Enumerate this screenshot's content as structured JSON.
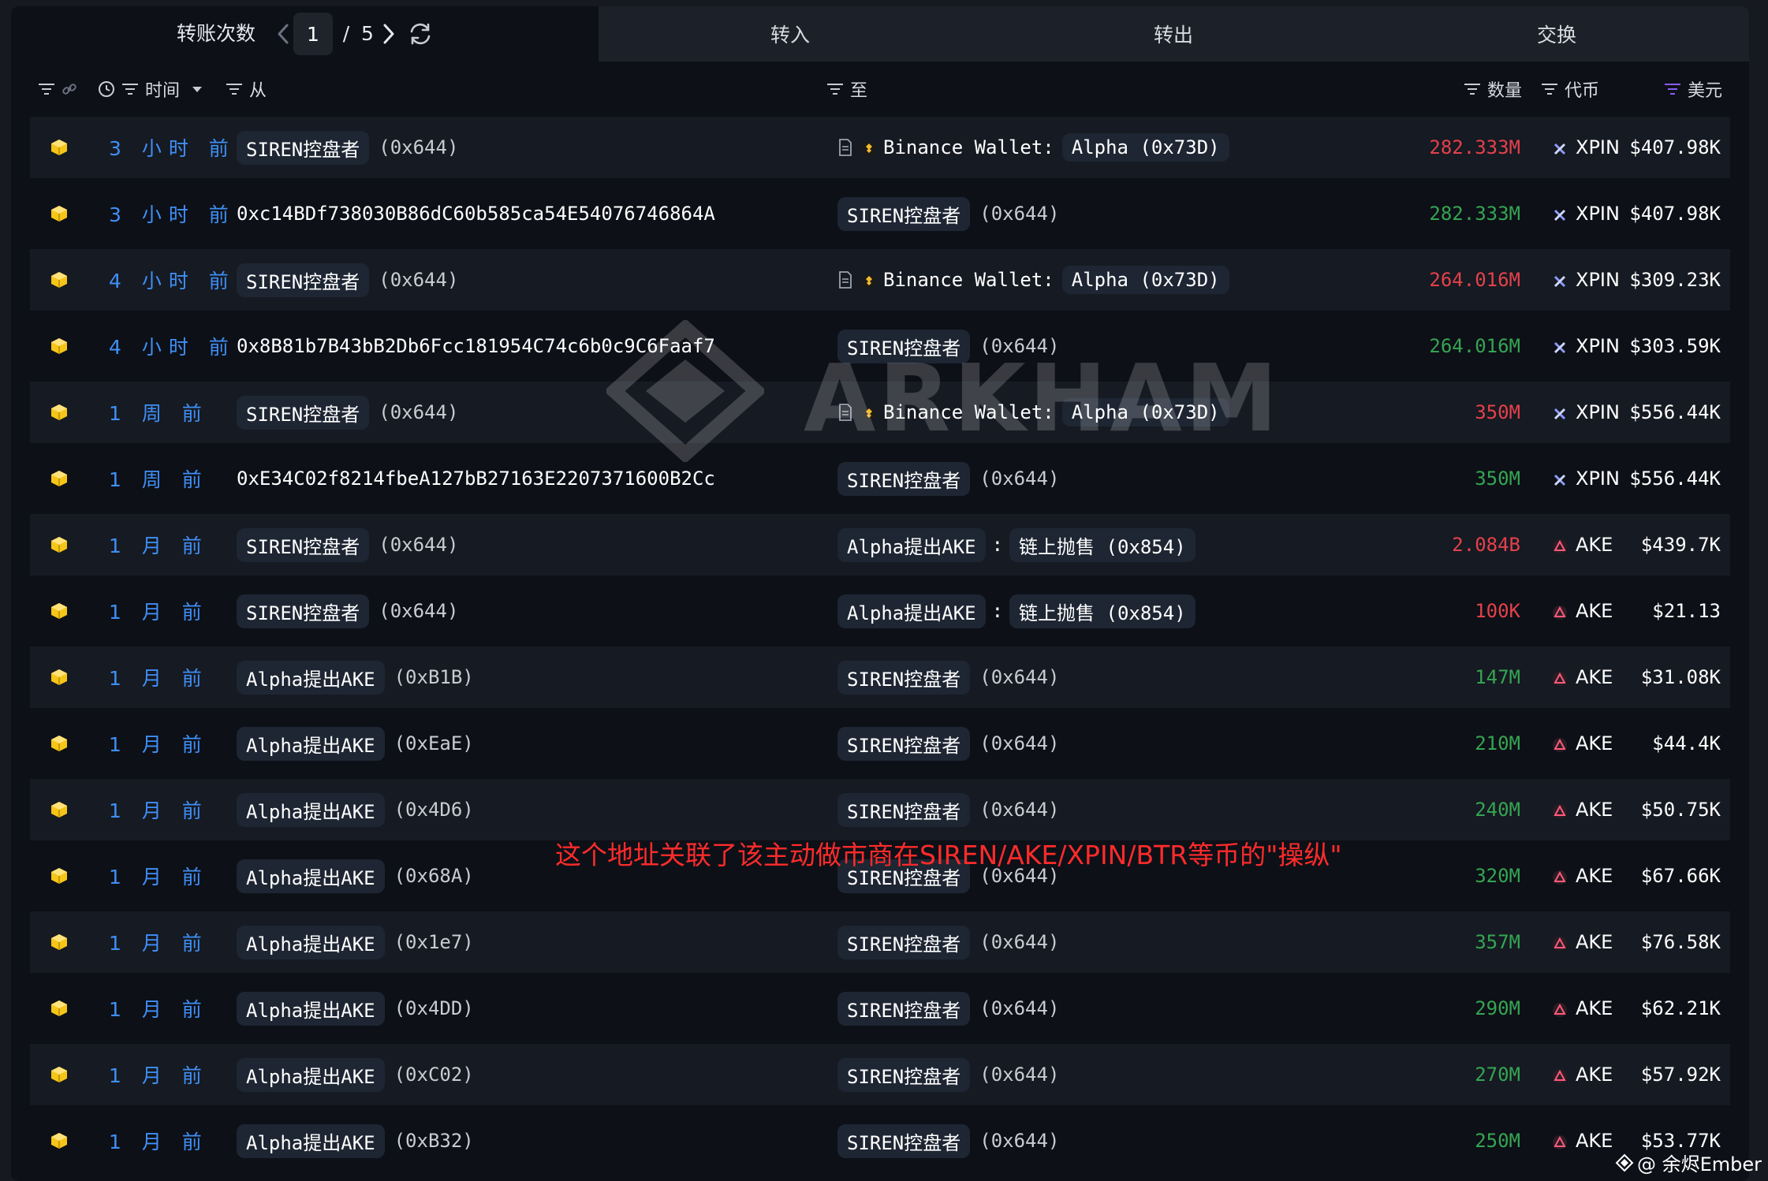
{
  "header": {
    "count_label": "转账次数",
    "page_current": "1",
    "page_sep": "/",
    "page_total": "5",
    "tabs": [
      "转入",
      "转出",
      "交换"
    ]
  },
  "columns": {
    "time": "时间",
    "from": "从",
    "to": "至",
    "qty": "数量",
    "token": "代币",
    "usd": "美元"
  },
  "colors": {
    "accent_blue": "#3f8ff7",
    "out_red": "#e5414b",
    "in_green": "#35a552",
    "cube_yellow": "#f5c518"
  },
  "rows": [
    {
      "time": "3 小时 前",
      "from_tag": "SIREN控盘者",
      "from_addr": "(0x644)",
      "to_type": "binance",
      "to_tag1": "Binance Wallet:",
      "to_tag2": "Alpha (0x73D)",
      "qty": "282.333M",
      "dir": "out",
      "token": "XPIN",
      "token_icon": "xpin-icon",
      "usd": "$407.98K"
    },
    {
      "time": "3 小时 前",
      "from_plain": "0xc14BDf738030B86dC60b585ca54E54076746864A",
      "to_tag": "SIREN控盘者",
      "to_addr": "(0x644)",
      "qty": "282.333M",
      "dir": "in",
      "token": "XPIN",
      "token_icon": "xpin-icon",
      "usd": "$407.98K"
    },
    {
      "time": "4 小时 前",
      "from_tag": "SIREN控盘者",
      "from_addr": "(0x644)",
      "to_type": "binance",
      "to_tag1": "Binance Wallet:",
      "to_tag2": "Alpha (0x73D)",
      "qty": "264.016M",
      "dir": "out",
      "token": "XPIN",
      "token_icon": "xpin-icon",
      "usd": "$309.23K"
    },
    {
      "time": "4 小时 前",
      "from_plain": "0x8B81b7B43bB2Db6Fcc181954C74c6b0c9C6Faaf7",
      "to_tag": "SIREN控盘者",
      "to_addr": "(0x644)",
      "qty": "264.016M",
      "dir": "in",
      "token": "XPIN",
      "token_icon": "xpin-icon",
      "usd": "$303.59K"
    },
    {
      "time": "1 周 前",
      "from_tag": "SIREN控盘者",
      "from_addr": "(0x644)",
      "to_type": "binance",
      "to_tag1": "Binance Wallet:",
      "to_tag2": "Alpha (0x73D)",
      "qty": "350M",
      "dir": "out",
      "token": "XPIN",
      "token_icon": "xpin-icon",
      "usd": "$556.44K"
    },
    {
      "time": "1 周 前",
      "from_plain": "0xE34C02f8214fbeA127bB27163E2207371600B2Cc",
      "to_tag": "SIREN控盘者",
      "to_addr": "(0x644)",
      "qty": "350M",
      "dir": "in",
      "token": "XPIN",
      "token_icon": "xpin-icon",
      "usd": "$556.44K"
    },
    {
      "time": "1 月 前",
      "from_tag": "SIREN控盘者",
      "from_addr": "(0x644)",
      "to_type": "pair",
      "to_tag1": "Alpha提出AKE",
      "to_tag2": "链上抛售 (0x854)",
      "qty": "2.084B",
      "dir": "out",
      "token": "AKE",
      "token_icon": "ake-icon",
      "usd": "$439.7K"
    },
    {
      "time": "1 月 前",
      "from_tag": "SIREN控盘者",
      "from_addr": "(0x644)",
      "to_type": "pair",
      "to_tag1": "Alpha提出AKE",
      "to_tag2": "链上抛售 (0x854)",
      "qty": "100K",
      "dir": "out",
      "token": "AKE",
      "token_icon": "ake-icon",
      "usd": "$21.13"
    },
    {
      "time": "1 月 前",
      "from_tag": "Alpha提出AKE",
      "from_addr": "(0xB1B)",
      "to_tag": "SIREN控盘者",
      "to_addr": "(0x644)",
      "qty": "147M",
      "dir": "in",
      "token": "AKE",
      "token_icon": "ake-icon",
      "usd": "$31.08K"
    },
    {
      "time": "1 月 前",
      "from_tag": "Alpha提出AKE",
      "from_addr": "(0xEaE)",
      "to_tag": "SIREN控盘者",
      "to_addr": "(0x644)",
      "qty": "210M",
      "dir": "in",
      "token": "AKE",
      "token_icon": "ake-icon",
      "usd": "$44.4K"
    },
    {
      "time": "1 月 前",
      "from_tag": "Alpha提出AKE",
      "from_addr": "(0x4D6)",
      "to_tag": "SIREN控盘者",
      "to_addr": "(0x644)",
      "qty": "240M",
      "dir": "in",
      "token": "AKE",
      "token_icon": "ake-icon",
      "usd": "$50.75K"
    },
    {
      "time": "1 月 前",
      "from_tag": "Alpha提出AKE",
      "from_addr": "(0x68A)",
      "to_tag": "SIREN控盘者",
      "to_addr": "(0x644)",
      "qty": "320M",
      "dir": "in",
      "token": "AKE",
      "token_icon": "ake-icon",
      "usd": "$67.66K"
    },
    {
      "time": "1 月 前",
      "from_tag": "Alpha提出AKE",
      "from_addr": "(0x1e7)",
      "to_tag": "SIREN控盘者",
      "to_addr": "(0x644)",
      "qty": "357M",
      "dir": "in",
      "token": "AKE",
      "token_icon": "ake-icon",
      "usd": "$76.58K"
    },
    {
      "time": "1 月 前",
      "from_tag": "Alpha提出AKE",
      "from_addr": "(0x4DD)",
      "to_tag": "SIREN控盘者",
      "to_addr": "(0x644)",
      "qty": "290M",
      "dir": "in",
      "token": "AKE",
      "token_icon": "ake-icon",
      "usd": "$62.21K"
    },
    {
      "time": "1 月 前",
      "from_tag": "Alpha提出AKE",
      "from_addr": "(0xC02)",
      "to_tag": "SIREN控盘者",
      "to_addr": "(0x644)",
      "qty": "270M",
      "dir": "in",
      "token": "AKE",
      "token_icon": "ake-icon",
      "usd": "$57.92K"
    },
    {
      "time": "1 月 前",
      "from_tag": "Alpha提出AKE",
      "from_addr": "(0xB32)",
      "to_tag": "SIREN控盘者",
      "to_addr": "(0x644)",
      "qty": "250M",
      "dir": "in",
      "token": "AKE",
      "token_icon": "ake-icon",
      "usd": "$53.77K"
    }
  ],
  "watermark": "ARKHAM",
  "annotation": "这个地址关联了该主动做市商在SIREN/AKE/XPIN/BTR等币的\"操纵\"",
  "credit": "@ 余烬Ember"
}
